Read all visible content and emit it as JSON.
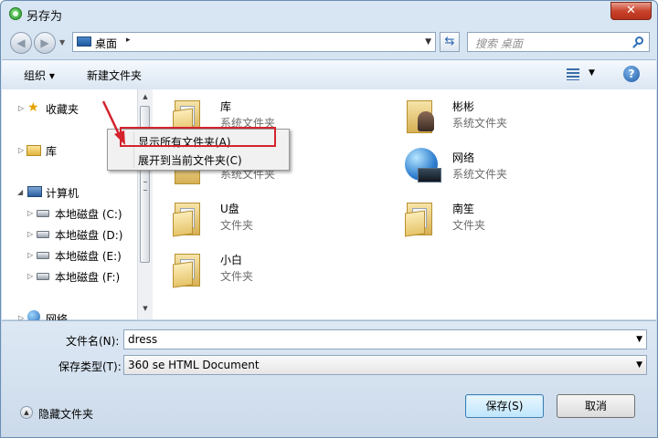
{
  "window": {
    "title": "另存为",
    "close_label": "✕"
  },
  "nav": {
    "back_icon": "back-arrow-icon",
    "forward_icon": "forward-arrow-icon"
  },
  "address": {
    "location": "桌面",
    "separator": "▸"
  },
  "search": {
    "placeholder": "搜索 桌面"
  },
  "toolbar": {
    "organize_label": "组织 ▾",
    "new_folder_label": "新建文件夹",
    "help_label": "?"
  },
  "sidebar": {
    "favorites": "收藏夹",
    "libraries": "库",
    "computer": "计算机",
    "drives": [
      "本地磁盘 (C:)",
      "本地磁盘 (D:)",
      "本地磁盘 (E:)",
      "本地磁盘 (F:)"
    ],
    "network": "网络"
  },
  "files": [
    {
      "name": "库",
      "type": "系统文件夹",
      "icon": "library-folder-icon"
    },
    {
      "name": "彬彬",
      "type": "系统文件夹",
      "icon": "user-folder-icon"
    },
    {
      "name": "",
      "type": "系统文件夹",
      "icon": "computer-icon"
    },
    {
      "name": "网络",
      "type": "系统文件夹",
      "icon": "network-globe-icon"
    },
    {
      "name": "U盘",
      "type": "文件夹",
      "icon": "folder-icon"
    },
    {
      "name": "南笙",
      "type": "文件夹",
      "icon": "folder-icon"
    },
    {
      "name": "小白",
      "type": "文件夹",
      "icon": "folder-icon"
    }
  ],
  "context_menu": {
    "items": [
      "显示所有文件夹(A)",
      "展开到当前文件夹(C)"
    ]
  },
  "form": {
    "filename_label": "文件名(N):",
    "filename_value": "dress",
    "filetype_label": "保存类型(T):",
    "filetype_value": "360 se HTML Document"
  },
  "buttons": {
    "save": "保存(S)",
    "cancel": "取消"
  },
  "hide_folders_label": "隐藏文件夹",
  "colors": {
    "highlight_box": "#d4232d",
    "arrow": "#d4232d"
  }
}
